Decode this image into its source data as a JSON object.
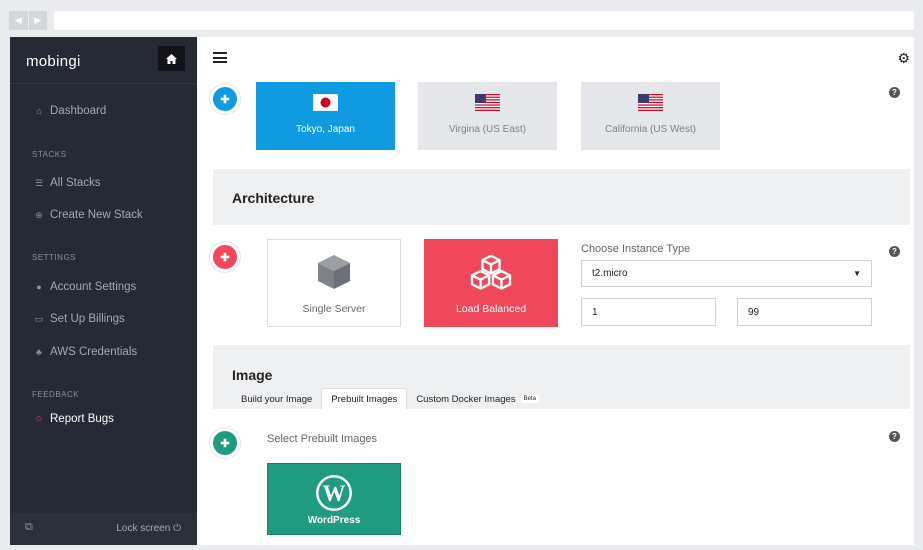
{
  "app": {
    "name": "mobingi"
  },
  "sidebar": {
    "nav_dashboard": "Dashboard",
    "section_stacks": "STACKS",
    "nav_all_stacks": "All Stacks",
    "nav_create_stack": "Create New Stack",
    "section_settings": "SETTINGS",
    "nav_account_settings": "Account Settings",
    "nav_billing": "Set Up Billings",
    "nav_aws": "AWS Credentials",
    "section_feedback": "FEEDBACK",
    "nav_report_bugs": "Report Bugs",
    "lock_screen": "Lock screen"
  },
  "regions": [
    {
      "label": "Tokyo, Japan",
      "flag": "japan-flag-icon",
      "selected": true
    },
    {
      "label": "Virgina (US East)",
      "flag": "us-flag-icon",
      "selected": false
    },
    {
      "label": "California (US West)",
      "flag": "us-flag-icon",
      "selected": false
    }
  ],
  "architecture": {
    "heading": "Architecture",
    "single_server": "Single Server",
    "load_balanced": "Load Balanced",
    "selected": "Load Balanced",
    "instance_type_label": "Choose Instance Type",
    "instance_type_value": "t2.micro",
    "min_instances": "1",
    "max_instances": "99"
  },
  "image": {
    "heading": "Image",
    "tabs": [
      "Build your Image",
      "Prebuilt Images",
      "Custom Docker Images"
    ],
    "active_tab": "Prebuilt Images",
    "beta_badge": "Beta",
    "select_label": "Select Prebuilt Images",
    "wordpress_label": "WordPress"
  },
  "colors": {
    "region_selected": "#0e9be1",
    "arch_selected": "#f0485b",
    "image_selected": "#1f9b7f",
    "sidebar_bg": "#262a35"
  }
}
